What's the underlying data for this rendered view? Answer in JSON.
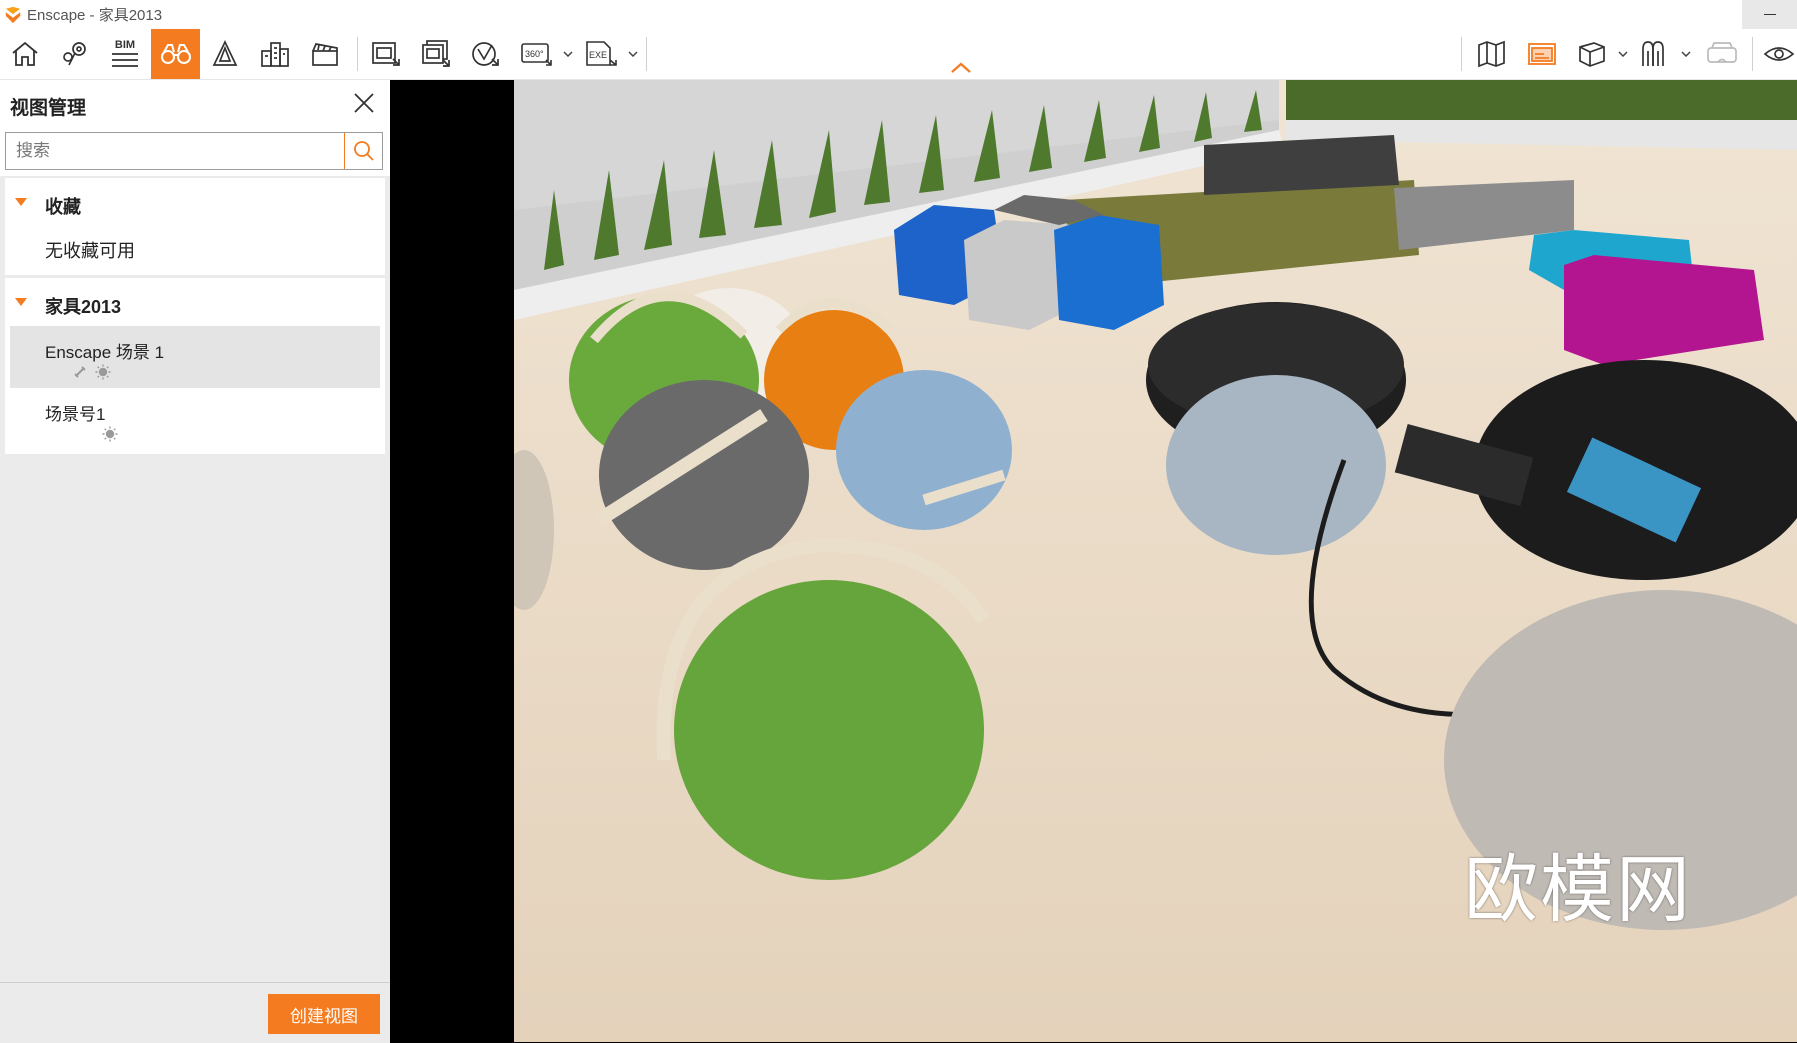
{
  "window": {
    "title": "Enscape - 家具2013"
  },
  "toolbar": {
    "bim_label": "BIM",
    "pano_label": "360°",
    "exe_label": "EXE",
    "accent_color": "#f47b20",
    "left_icons": [
      "home-icon",
      "location-pins-icon",
      "bim-list-icon",
      "binoculars-icon",
      "site-context-icon",
      "buildings-icon",
      "clapperboard-icon",
      "screenshot-icon",
      "batch-render-icon",
      "web-standalone-icon",
      "panorama-360-icon",
      "exe-export-icon"
    ],
    "right_icons": [
      "map-icon",
      "visual-settings-icon",
      "asset-library-icon",
      "material-editor-icon",
      "vr-headset-icon",
      "eye-icon"
    ]
  },
  "panel": {
    "title": "视图管理",
    "search_placeholder": "搜索",
    "favorites": {
      "label": "收藏",
      "empty_text": "无收藏可用"
    },
    "project": {
      "label": "家具2013",
      "views": [
        {
          "name": "Enscape 场景 1",
          "selected": true,
          "icons": [
            "link-icon",
            "sun-icon"
          ]
        },
        {
          "name": "场景号1",
          "selected": false,
          "icons": [
            "sun-icon"
          ]
        }
      ]
    },
    "create_button": "创建视图"
  },
  "viewport": {
    "watermark": "欧模网"
  }
}
